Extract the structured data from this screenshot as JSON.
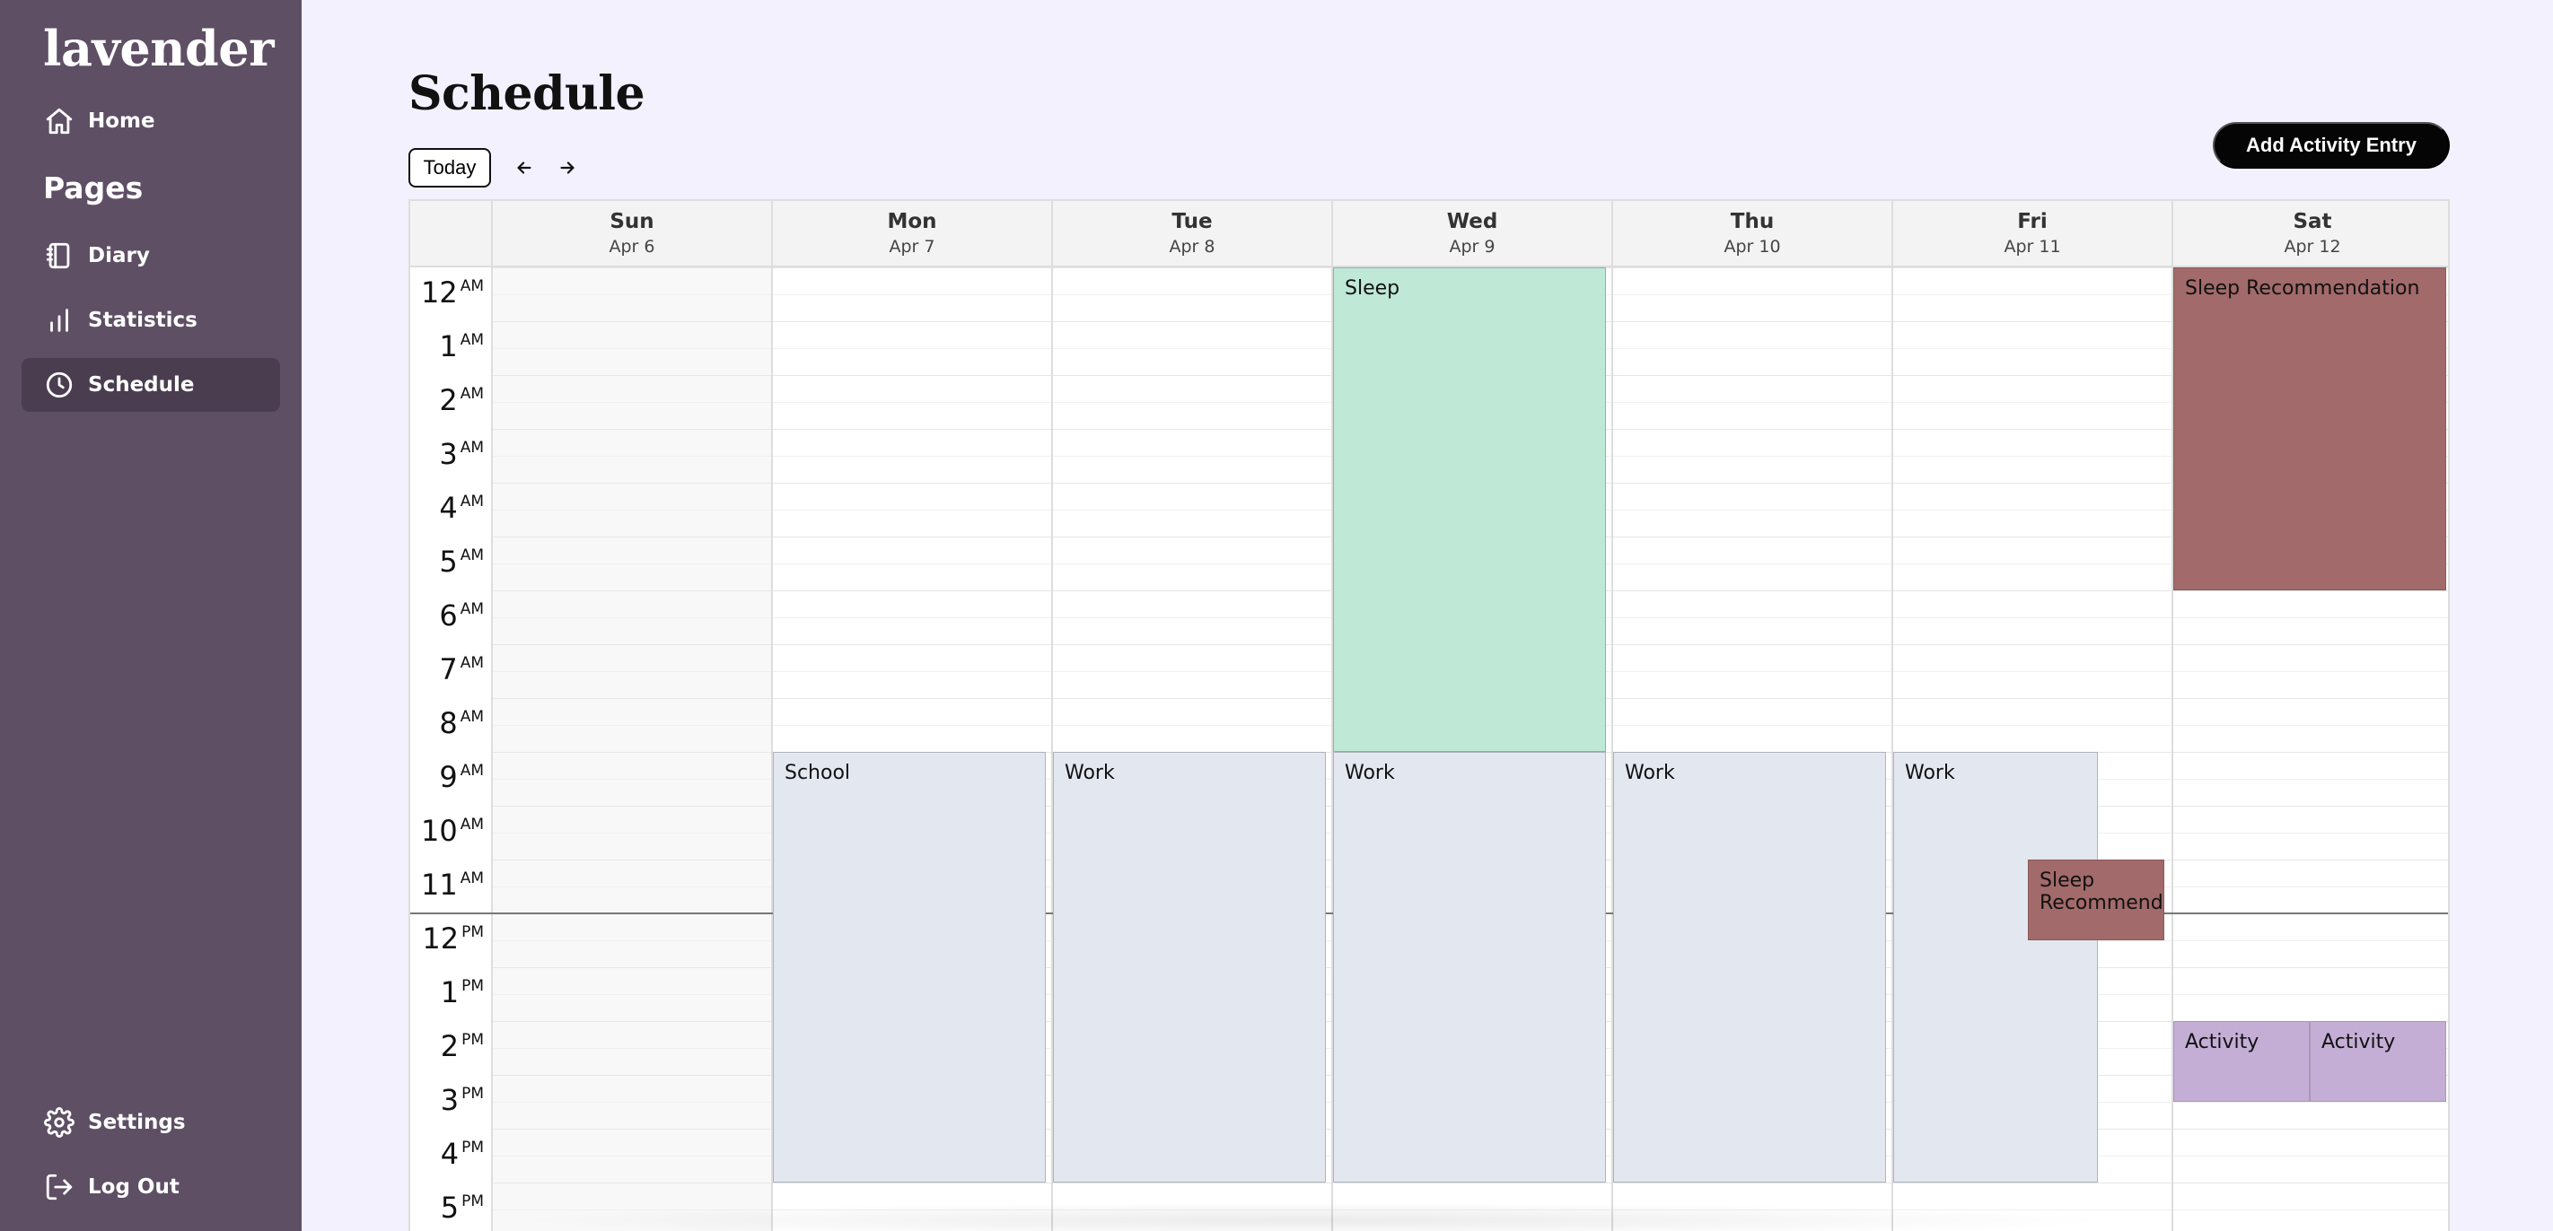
{
  "app": {
    "logo": "lavender"
  },
  "sidebar": {
    "nav_top": [
      {
        "label": "Home",
        "icon": "home-icon"
      }
    ],
    "section_title": "Pages",
    "pages": [
      {
        "label": "Diary",
        "icon": "notebook-icon"
      },
      {
        "label": "Statistics",
        "icon": "bar-chart-icon"
      },
      {
        "label": "Schedule",
        "icon": "clock-icon",
        "active": true
      }
    ],
    "bottom": [
      {
        "label": "Settings",
        "icon": "gear-icon"
      },
      {
        "label": "Log Out",
        "icon": "logout-icon"
      }
    ],
    "colors": {
      "background": "#5e4f65",
      "active": "#4a3d50"
    }
  },
  "main": {
    "title": "Schedule",
    "today_label": "Today",
    "prev_icon": "arrow-left-icon",
    "next_icon": "arrow-right-icon",
    "add_button_label": "Add Activity Entry"
  },
  "calendar": {
    "days": [
      {
        "name": "Sun",
        "date": "Apr 6"
      },
      {
        "name": "Mon",
        "date": "Apr 7"
      },
      {
        "name": "Tue",
        "date": "Apr 8"
      },
      {
        "name": "Wed",
        "date": "Apr 9"
      },
      {
        "name": "Thu",
        "date": "Apr 10"
      },
      {
        "name": "Fri",
        "date": "Apr 11"
      },
      {
        "name": "Sat",
        "date": "Apr 12"
      }
    ],
    "hours": [
      {
        "h": "12",
        "ap": "AM"
      },
      {
        "h": "1",
        "ap": "AM"
      },
      {
        "h": "2",
        "ap": "AM"
      },
      {
        "h": "3",
        "ap": "AM"
      },
      {
        "h": "4",
        "ap": "AM"
      },
      {
        "h": "5",
        "ap": "AM"
      },
      {
        "h": "6",
        "ap": "AM"
      },
      {
        "h": "7",
        "ap": "AM"
      },
      {
        "h": "8",
        "ap": "AM"
      },
      {
        "h": "9",
        "ap": "AM"
      },
      {
        "h": "10",
        "ap": "AM"
      },
      {
        "h": "11",
        "ap": "AM"
      },
      {
        "h": "12",
        "ap": "PM"
      },
      {
        "h": "1",
        "ap": "PM"
      },
      {
        "h": "2",
        "ap": "PM"
      },
      {
        "h": "3",
        "ap": "PM"
      },
      {
        "h": "4",
        "ap": "PM"
      },
      {
        "h": "5",
        "ap": "PM"
      }
    ],
    "now_hour": 12,
    "events": [
      {
        "title": "Sleep",
        "day": 3,
        "start": 0,
        "end": 9,
        "kind": "sleep"
      },
      {
        "title": "Sleep Recommendation",
        "day": 6,
        "start": 0,
        "end": 6,
        "kind": "rec"
      },
      {
        "title": "School",
        "day": 1,
        "start": 9,
        "end": 17,
        "kind": "work"
      },
      {
        "title": "Work",
        "day": 2,
        "start": 9,
        "end": 17,
        "kind": "work"
      },
      {
        "title": "Work",
        "day": 3,
        "start": 9,
        "end": 17,
        "kind": "work"
      },
      {
        "title": "Work",
        "day": 4,
        "start": 9,
        "end": 17,
        "kind": "work"
      },
      {
        "title": "Work",
        "day": 5,
        "start": 9,
        "end": 17,
        "kind": "work"
      },
      {
        "title": "Sleep Recommendation",
        "day": 5,
        "start": 11,
        "end": 12.5,
        "kind": "rec"
      },
      {
        "title": "Activity",
        "day": 6,
        "start": 14,
        "end": 15.5,
        "kind": "activity",
        "slot": 0
      },
      {
        "title": "Activity",
        "day": 6,
        "start": 14,
        "end": 15.5,
        "kind": "activity",
        "slot": 1
      }
    ]
  }
}
